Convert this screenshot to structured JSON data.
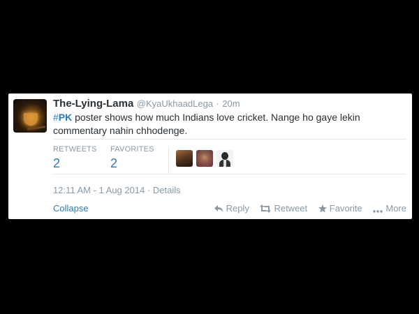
{
  "tweet": {
    "author_name": "The-Lying-Lama",
    "handle": "@KyaUkhaadLega",
    "separator": "·",
    "age": "20m",
    "hashtag_symbol": "#",
    "hashtag": "PK",
    "text_rest": " poster shows how much Indians love cricket. Nange ho gaye lekin commentary nahin chhodenge."
  },
  "stats": {
    "retweets_label": "RETWEETS",
    "retweets_value": "2",
    "favorites_label": "FAVORITES",
    "favorites_value": "2"
  },
  "meta": {
    "timestamp": "12:11 AM - 1 Aug 2014",
    "separator": "·",
    "details_label": "Details"
  },
  "actions": {
    "collapse_label": "Collapse",
    "reply_label": "Reply",
    "retweet_label": "Retweet",
    "favorite_label": "Favorite",
    "more_label": "More"
  },
  "colors": {
    "background": "#000000",
    "card": "#ffffff",
    "link": "#2b7bb9",
    "muted": "#8899a6",
    "text": "#292f33"
  },
  "icons": [
    "reply-icon",
    "retweet-icon",
    "star-icon",
    "more-dots-icon"
  ]
}
